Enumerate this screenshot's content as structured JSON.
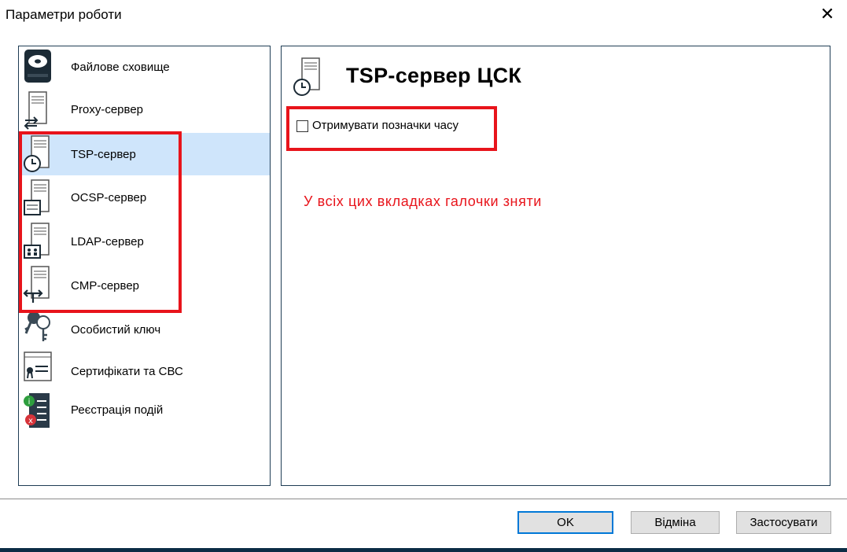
{
  "window": {
    "title": "Параметри роботи",
    "close_icon": "close-icon"
  },
  "sidebar": {
    "items": [
      {
        "label": "Файлове сховище",
        "icon": "disk-storage-icon",
        "selected": false
      },
      {
        "label": "Proxy-сервер",
        "icon": "proxy-server-icon",
        "selected": false
      },
      {
        "label": "TSP-сервер",
        "icon": "tsp-server-icon",
        "selected": true
      },
      {
        "label": "OCSP-сервер",
        "icon": "ocsp-server-icon",
        "selected": false
      },
      {
        "label": "LDAP-сервер",
        "icon": "ldap-server-icon",
        "selected": false
      },
      {
        "label": "CMP-сервер",
        "icon": "cmp-server-icon",
        "selected": false
      },
      {
        "label": "Особистий ключ",
        "icon": "private-key-icon",
        "selected": false
      },
      {
        "label": "Сертифікати та СВС",
        "icon": "certificates-icon",
        "selected": false
      },
      {
        "label": "Реєстрація подій",
        "icon": "event-log-icon",
        "selected": false
      }
    ]
  },
  "main": {
    "header_title": "TSP-сервер ЦСК",
    "checkbox_label": "Отримувати позначки часу",
    "checkbox_checked": false,
    "annotation": "У всіх цих вкладках галочки зняти"
  },
  "buttons": {
    "ok": "OK",
    "cancel": "Відміна",
    "apply": "Застосувати"
  },
  "colors": {
    "highlight": "#e8141b",
    "selection": "#cfe5fb",
    "accent": "#0078d7"
  }
}
